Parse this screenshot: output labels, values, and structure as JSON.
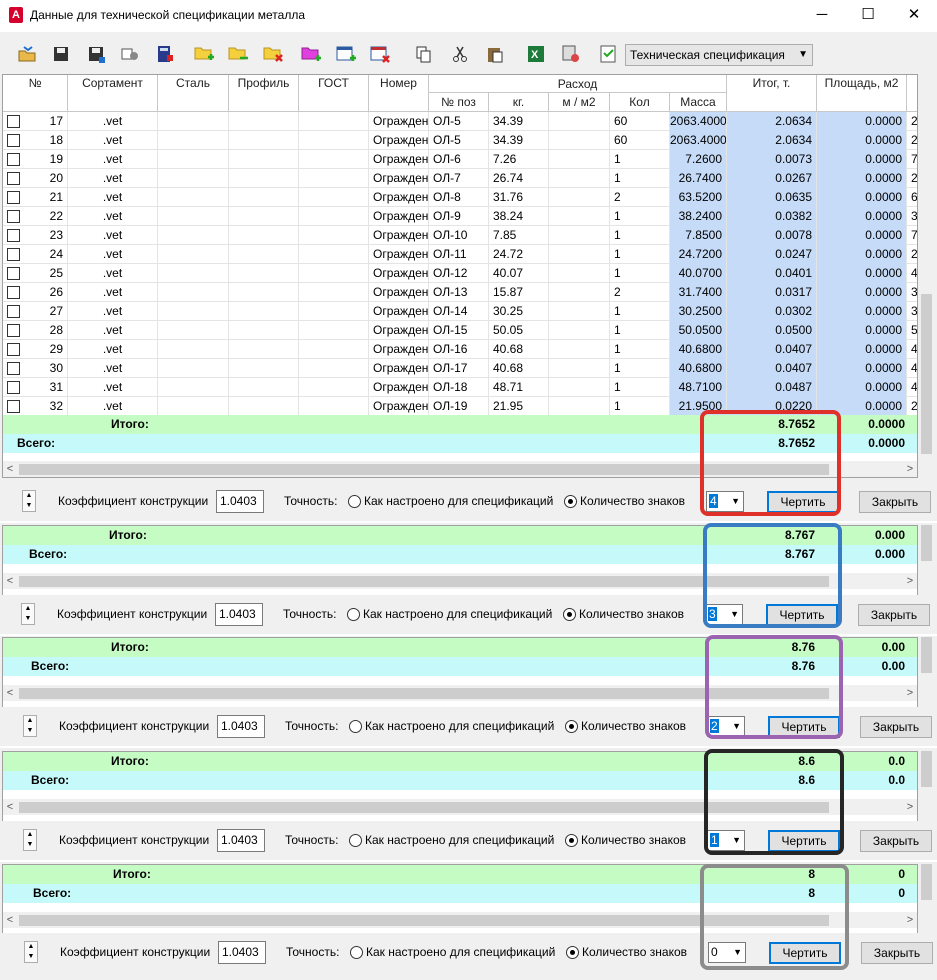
{
  "window": {
    "title": "Данные для технической спецификации металла",
    "minimize": "─",
    "maximize": "☐",
    "close": "✕"
  },
  "toolbar": {
    "combo_value": "Техническая спецификация",
    "icons": [
      "open-folder-icon",
      "save-icon",
      "save-as-icon",
      "settings-icon",
      "calculator-icon",
      "folder-add-icon",
      "folder-move-icon",
      "folder-delete-icon",
      "pink-folder-add-icon",
      "table-add-icon",
      "table-delete-icon",
      "copy-icon",
      "cut-icon",
      "paste-icon",
      "excel-icon",
      "export-icon",
      "check-icon"
    ]
  },
  "grid": {
    "headers": {
      "num": "№",
      "sort": "Сортамент",
      "steel": "Сталь",
      "profile": "Профиль",
      "gost": "ГОСТ",
      "number": "Номер",
      "rashod": "Расход",
      "npoz": "№ поз",
      "kg": "кг.",
      "m2": "м / м2",
      "kol": "Кол",
      "mass": "Масса",
      "itog": "Итог, т.",
      "area": "Площадь, м2"
    },
    "rows": [
      {
        "n": "17",
        "sort": ".vet",
        "num": "Огражден",
        "poz": "ОЛ-5",
        "kg": "34.39",
        "kol": "60",
        "mass": "2063.4000",
        "itog": "2.0634",
        "area": "0.0000",
        "ex": "2"
      },
      {
        "n": "18",
        "sort": ".vet",
        "num": "Огражден",
        "poz": "ОЛ-5",
        "kg": "34.39",
        "kol": "60",
        "mass": "2063.4000",
        "itog": "2.0634",
        "area": "0.0000",
        "ex": "2"
      },
      {
        "n": "19",
        "sort": ".vet",
        "num": "Огражден",
        "poz": "ОЛ-6",
        "kg": "7.26",
        "kol": "1",
        "mass": "7.2600",
        "itog": "0.0073",
        "area": "0.0000",
        "ex": "7"
      },
      {
        "n": "20",
        "sort": ".vet",
        "num": "Огражден",
        "poz": "ОЛ-7",
        "kg": "26.74",
        "kol": "1",
        "mass": "26.7400",
        "itog": "0.0267",
        "area": "0.0000",
        "ex": "2"
      },
      {
        "n": "21",
        "sort": ".vet",
        "num": "Огражден",
        "poz": "ОЛ-8",
        "kg": "31.76",
        "kol": "2",
        "mass": "63.5200",
        "itog": "0.0635",
        "area": "0.0000",
        "ex": "6"
      },
      {
        "n": "22",
        "sort": ".vet",
        "num": "Огражден",
        "poz": "ОЛ-9",
        "kg": "38.24",
        "kol": "1",
        "mass": "38.2400",
        "itog": "0.0382",
        "area": "0.0000",
        "ex": "3"
      },
      {
        "n": "23",
        "sort": ".vet",
        "num": "Огражден",
        "poz": "ОЛ-10",
        "kg": "7.85",
        "kol": "1",
        "mass": "7.8500",
        "itog": "0.0078",
        "area": "0.0000",
        "ex": "7"
      },
      {
        "n": "24",
        "sort": ".vet",
        "num": "Огражден",
        "poz": "ОЛ-11",
        "kg": "24.72",
        "kol": "1",
        "mass": "24.7200",
        "itog": "0.0247",
        "area": "0.0000",
        "ex": "2"
      },
      {
        "n": "25",
        "sort": ".vet",
        "num": "Огражден",
        "poz": "ОЛ-12",
        "kg": "40.07",
        "kol": "1",
        "mass": "40.0700",
        "itog": "0.0401",
        "area": "0.0000",
        "ex": "4"
      },
      {
        "n": "26",
        "sort": ".vet",
        "num": "Огражден",
        "poz": "ОЛ-13",
        "kg": "15.87",
        "kol": "2",
        "mass": "31.7400",
        "itog": "0.0317",
        "area": "0.0000",
        "ex": "3"
      },
      {
        "n": "27",
        "sort": ".vet",
        "num": "Огражден",
        "poz": "ОЛ-14",
        "kg": "30.25",
        "kol": "1",
        "mass": "30.2500",
        "itog": "0.0302",
        "area": "0.0000",
        "ex": "3"
      },
      {
        "n": "28",
        "sort": ".vet",
        "num": "Огражден",
        "poz": "ОЛ-15",
        "kg": "50.05",
        "kol": "1",
        "mass": "50.0500",
        "itog": "0.0500",
        "area": "0.0000",
        "ex": "5"
      },
      {
        "n": "29",
        "sort": ".vet",
        "num": "Огражден",
        "poz": "ОЛ-16",
        "kg": "40.68",
        "kol": "1",
        "mass": "40.6800",
        "itog": "0.0407",
        "area": "0.0000",
        "ex": "4"
      },
      {
        "n": "30",
        "sort": ".vet",
        "num": "Огражден",
        "poz": "ОЛ-17",
        "kg": "40.68",
        "kol": "1",
        "mass": "40.6800",
        "itog": "0.0407",
        "area": "0.0000",
        "ex": "4"
      },
      {
        "n": "31",
        "sort": ".vet",
        "num": "Огражден",
        "poz": "ОЛ-18",
        "kg": "48.71",
        "kol": "1",
        "mass": "48.7100",
        "itog": "0.0487",
        "area": "0.0000",
        "ex": "4"
      },
      {
        "n": "32",
        "sort": ".vet",
        "num": "Огражден",
        "poz": "ОЛ-19",
        "kg": "21.95",
        "kol": "1",
        "mass": "21.9500",
        "itog": "0.0220",
        "area": "0.0000",
        "ex": "2"
      }
    ]
  },
  "labels": {
    "itogo": "Итого:",
    "vsego": "Всего:",
    "coef": "Коэффициент конструкции",
    "coef_value": "1.0403",
    "precision": "Точность:",
    "opt_spec": "Как настроено для спецификаций",
    "opt_digits": "Количество знаков",
    "draw": "Чертить",
    "close": "Закрыть"
  },
  "variants": [
    {
      "digits": "4",
      "itogo": "8.7652",
      "vsego": "8.7652",
      "area_itogo": "0.0000",
      "area_vsego": "0.0000",
      "box_color": "#e0302a"
    },
    {
      "digits": "3",
      "itogo": "8.767",
      "vsego": "8.767",
      "area_itogo": "0.000",
      "area_vsego": "0.000",
      "box_color": "#3a7cc4"
    },
    {
      "digits": "2",
      "itogo": "8.76",
      "vsego": "8.76",
      "area_itogo": "0.00",
      "area_vsego": "0.00",
      "box_color": "#9b64b0"
    },
    {
      "digits": "1",
      "itogo": "8.6",
      "vsego": "8.6",
      "area_itogo": "0.0",
      "area_vsego": "0.0",
      "box_color": "#262626"
    },
    {
      "digits": "0",
      "itogo": "8",
      "vsego": "8",
      "area_itogo": "0",
      "area_vsego": "0",
      "box_color": "#8c8c8c"
    }
  ]
}
